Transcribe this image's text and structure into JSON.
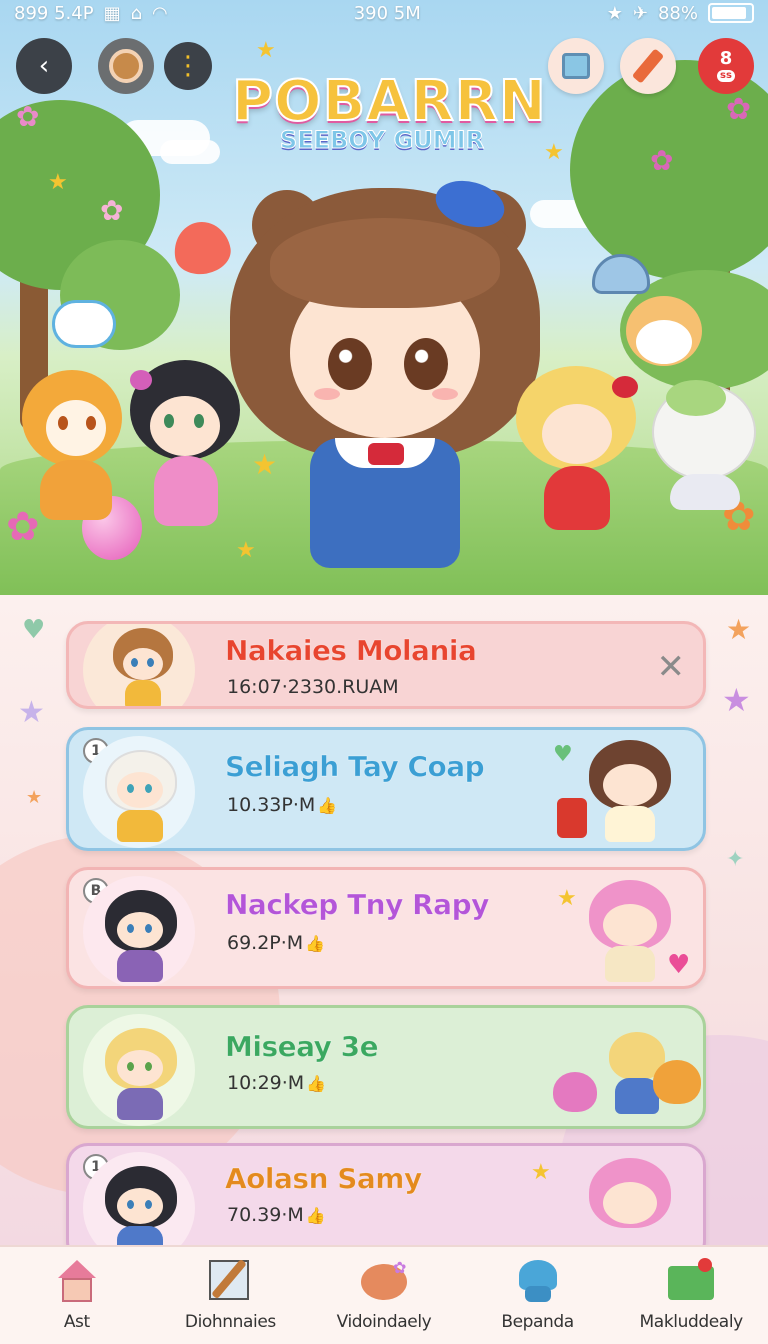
{
  "status_bar": {
    "left": "899 5.4P",
    "center": "390 5M",
    "battery": "88%"
  },
  "header": {
    "logo_main": "POBARRN",
    "logo_sub": "SEEBOY GUMIR",
    "badge_number": "8",
    "badge_text": "ss"
  },
  "list": {
    "items": [
      {
        "title": "Nakaies Molania",
        "subtitle": "16:07·2330.RUAM",
        "badge": ""
      },
      {
        "title": "Seliagh Tay Coap",
        "subtitle": "10.33P·M",
        "badge": "1"
      },
      {
        "title": "Nackep Tny Rapy",
        "subtitle": "69.2P·M",
        "badge": "B"
      },
      {
        "title": "Miseay 3e",
        "subtitle": "10:29·M",
        "badge": ""
      },
      {
        "title": "Aolasn Samy",
        "subtitle": "70.39·M",
        "badge": "1"
      }
    ]
  },
  "nav": {
    "items": [
      {
        "label": "Ast",
        "icon": "home-icon"
      },
      {
        "label": "Diohnnaies",
        "icon": "paint-brush-icon"
      },
      {
        "label": "Vidoindaely",
        "icon": "chat-bubble-icon"
      },
      {
        "label": "Bepanda",
        "icon": "character-icon"
      },
      {
        "label": "Makluddealy",
        "icon": "folder-icon"
      }
    ]
  },
  "colors": {
    "card_1": "#f8d4d4",
    "card_2": "#cfe8f5",
    "card_3": "#fbe3e3",
    "card_4": "#dcefd6",
    "card_5": "#f4d9ea"
  }
}
